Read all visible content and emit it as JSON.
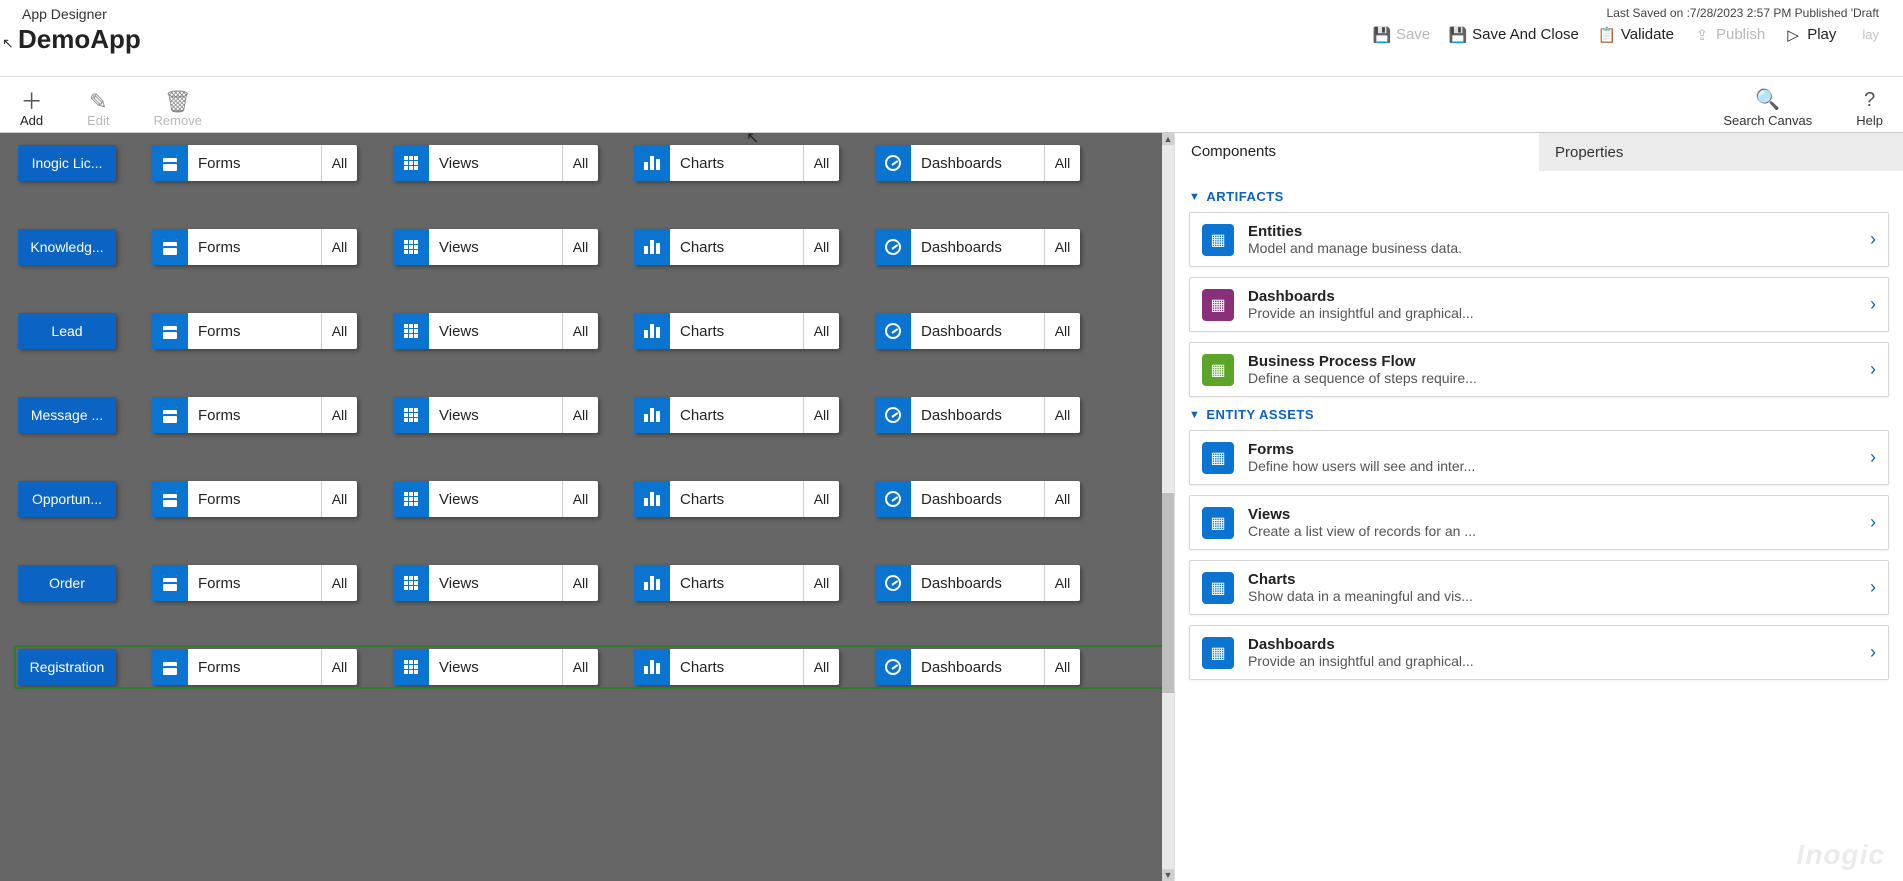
{
  "header": {
    "designer_label": "App Designer",
    "app_name": "DemoApp",
    "last_saved": "Last Saved on :7/28/2023 2:57 PM Published 'Draft",
    "actions": {
      "save": "Save",
      "save_close": "Save And Close",
      "validate": "Validate",
      "publish": "Publish",
      "play": "Play",
      "play_ghost": "lay"
    }
  },
  "toolbar": {
    "add": "Add",
    "edit": "Edit",
    "remove": "Remove",
    "search": "Search Canvas",
    "help": "Help"
  },
  "canvas": {
    "asset_labels": {
      "forms": "Forms",
      "views": "Views",
      "charts": "Charts",
      "dashboards": "Dashboards"
    },
    "all_label": "All",
    "entities": [
      {
        "name": "Inogic Lic...",
        "selected": false
      },
      {
        "name": "Knowledg...",
        "selected": false
      },
      {
        "name": "Lead",
        "selected": false
      },
      {
        "name": "Message ...",
        "selected": false
      },
      {
        "name": "Opportun...",
        "selected": false
      },
      {
        "name": "Order",
        "selected": false
      },
      {
        "name": "Registration",
        "selected": true
      }
    ]
  },
  "right_panel": {
    "tabs": {
      "components": "Components",
      "properties": "Properties",
      "active": "components"
    },
    "sections": {
      "artifacts": {
        "title": "ARTIFACTS",
        "items": [
          {
            "title": "Entities",
            "desc": "Model and manage business data.",
            "color": "ci-blue"
          },
          {
            "title": "Dashboards",
            "desc": "Provide an insightful and graphical...",
            "color": "ci-purple"
          },
          {
            "title": "Business Process Flow",
            "desc": "Define a sequence of steps require...",
            "color": "ci-green"
          }
        ]
      },
      "entity_assets": {
        "title": "ENTITY ASSETS",
        "items": [
          {
            "title": "Forms",
            "desc": "Define how users will see and inter...",
            "color": "ci-blue"
          },
          {
            "title": "Views",
            "desc": "Create a list view of records for an ...",
            "color": "ci-blue"
          },
          {
            "title": "Charts",
            "desc": "Show data in a meaningful and vis...",
            "color": "ci-blue"
          },
          {
            "title": "Dashboards",
            "desc": "Provide an insightful and graphical...",
            "color": "ci-blue"
          }
        ]
      }
    }
  },
  "watermark": "Inogic"
}
